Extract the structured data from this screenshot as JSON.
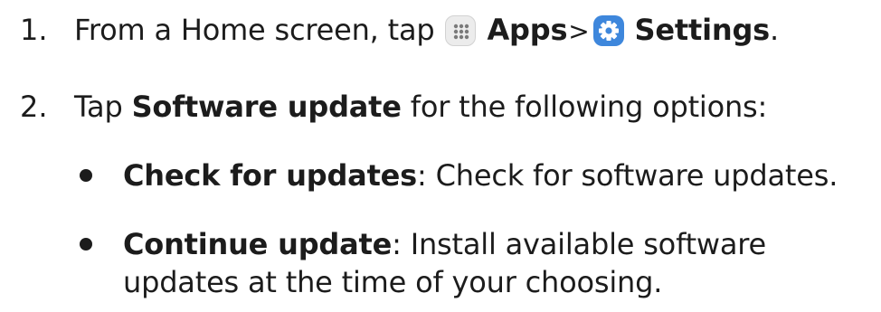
{
  "steps": [
    {
      "number": "1.",
      "prefix": "From a Home screen, tap",
      "apps_label": "Apps",
      "separator": ">",
      "settings_label": "Settings",
      "suffix": "."
    },
    {
      "number": "2.",
      "prefix": "Tap",
      "bold": "Software update",
      "suffix": "for the following options:"
    }
  ],
  "options": [
    {
      "title": "Check for updates",
      "colon": ":",
      "desc_lines": [
        "Check for software updates."
      ]
    },
    {
      "title": "Continue update",
      "colon": ":",
      "desc_lines": [
        "Install available software",
        "updates at the time of your choosing."
      ]
    }
  ],
  "icons": {
    "apps": "apps-grid-icon",
    "settings": "gear-icon"
  },
  "colors": {
    "text": "#1c1c1c",
    "settings_icon_bg": "#3e87dc",
    "apps_icon_bg": "#ececec"
  }
}
